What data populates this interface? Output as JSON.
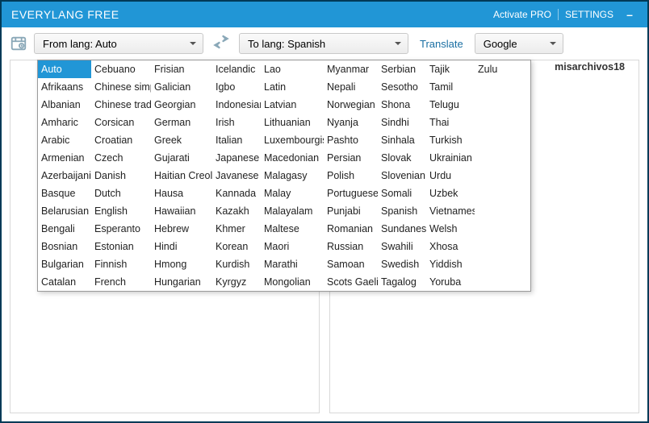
{
  "titlebar": {
    "title": "EVERYLANG FREE",
    "activate": "Activate PRO",
    "settings": "SETTINGS",
    "minimize": "–"
  },
  "toolbar": {
    "from_label": "From lang: Auto",
    "to_label": "To lang: Spanish",
    "translate": "Translate",
    "engine": "Google"
  },
  "watermark": "misarchivos18",
  "dropdown_selected": "Auto",
  "dropdown_columns": [
    [
      "Auto",
      "Afrikaans",
      "Albanian",
      "Amharic",
      "Arabic",
      "Armenian",
      "Azerbaijani",
      "Basque",
      "Belarusian",
      "Bengali",
      "Bosnian",
      "Bulgarian",
      "Catalan"
    ],
    [
      "Cebuano",
      "Chinese simp.",
      "Chinese trad.",
      "Corsican",
      "Croatian",
      "Czech",
      "Danish",
      "Dutch",
      "English",
      "Esperanto",
      "Estonian",
      "Finnish",
      "French"
    ],
    [
      "Frisian",
      "Galician",
      "Georgian",
      "German",
      "Greek",
      "Gujarati",
      "Haitian Creole",
      "Hausa",
      "Hawaiian",
      "Hebrew",
      "Hindi",
      "Hmong",
      "Hungarian"
    ],
    [
      "Icelandic",
      "Igbo",
      "Indonesian",
      "Irish",
      "Italian",
      "Japanese",
      "Javanese",
      "Kannada",
      "Kazakh",
      "Khmer",
      "Korean",
      "Kurdish",
      "Kyrgyz"
    ],
    [
      "Lao",
      "Latin",
      "Latvian",
      "Lithuanian",
      "Luxembourgish",
      "Macedonian",
      "Malagasy",
      "Malay",
      "Malayalam",
      "Maltese",
      "Maori",
      "Marathi",
      "Mongolian"
    ],
    [
      "Myanmar",
      "Nepali",
      "Norwegian",
      "Nyanja",
      "Pashto",
      "Persian",
      "Polish",
      "Portuguese",
      "Punjabi",
      "Romanian",
      "Russian",
      "Samoan",
      "Scots Gaelic"
    ],
    [
      "Serbian",
      "Sesotho",
      "Shona",
      "Sindhi",
      "Sinhala",
      "Slovak",
      "Slovenian",
      "Somali",
      "Spanish",
      "Sundanese",
      "Swahili",
      "Swedish",
      "Tagalog"
    ],
    [
      "Tajik",
      "Tamil",
      "Telugu",
      "Thai",
      "Turkish",
      "Ukrainian",
      "Urdu",
      "Uzbek",
      "Vietnamese",
      "Welsh",
      "Xhosa",
      "Yiddish",
      "Yoruba"
    ],
    [
      "Zulu"
    ]
  ]
}
